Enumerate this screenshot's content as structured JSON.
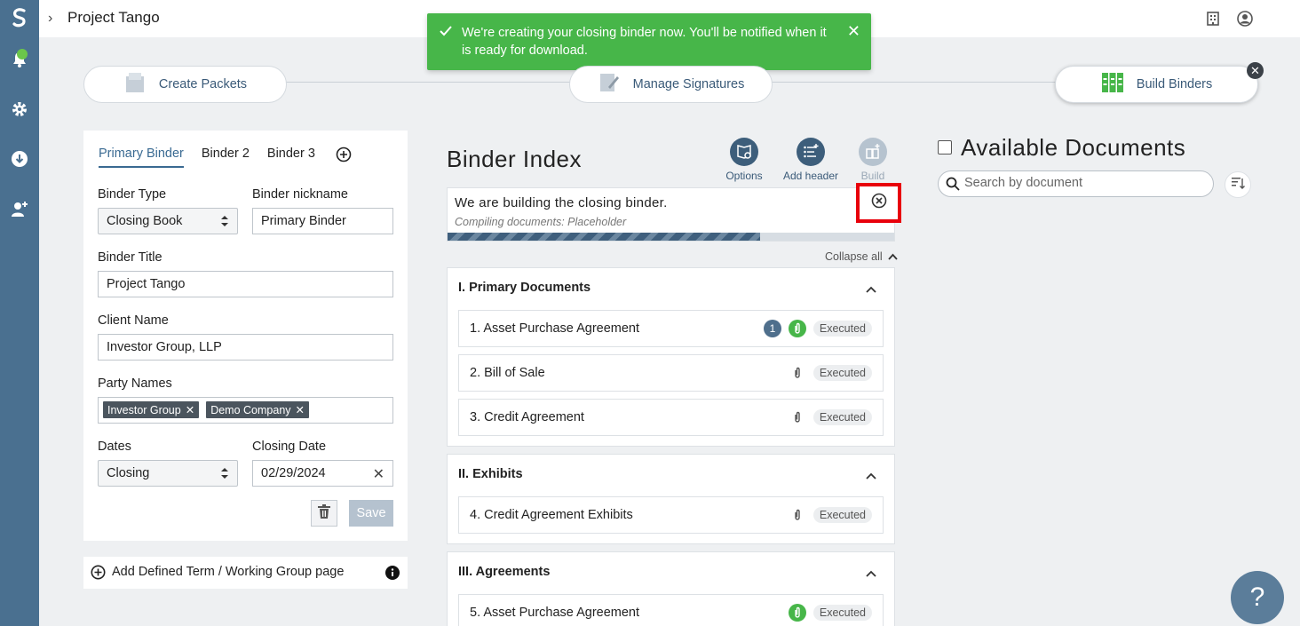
{
  "app": {
    "title": "Project Tango"
  },
  "toast": {
    "message": "We're creating your closing binder now. You'll be notified when it is ready for download."
  },
  "steps": [
    {
      "label": "Create Packets",
      "icon": "packet-icon"
    },
    {
      "label": "Manage Signatures",
      "icon": "signature-icon"
    },
    {
      "label": "Build Binders",
      "icon": "binders-icon"
    }
  ],
  "binder_tabs": [
    "Primary Binder",
    "Binder 2",
    "Binder 3"
  ],
  "form": {
    "binder_type_label": "Binder Type",
    "binder_type_value": "Closing Book",
    "nickname_label": "Binder nickname",
    "nickname_value": "Primary Binder",
    "title_label": "Binder Title",
    "title_value": "Project Tango",
    "client_label": "Client Name",
    "client_value": "Investor Group, LLP",
    "parties_label": "Party Names",
    "parties": [
      "Investor Group",
      "Demo Company"
    ],
    "dates_label": "Dates",
    "dates_value": "Closing",
    "closing_date_label": "Closing Date",
    "closing_date_value": "02/29/2024",
    "save_label": "Save"
  },
  "add_term": {
    "label": "Add Defined Term / Working Group page"
  },
  "binder_index": {
    "title": "Binder Index",
    "tools": {
      "options": "Options",
      "add_header": "Add header",
      "build": "Build"
    },
    "build_status": {
      "title": "We are building the closing binder.",
      "subtitle": "Compiling documents: Placeholder",
      "progress": 0.7
    },
    "collapse_all": "Collapse all",
    "sections": [
      {
        "title": "I. Primary Documents",
        "docs": [
          {
            "name": "1. Asset Purchase Agreement",
            "status": "Executed",
            "count": "1",
            "clip": "green"
          },
          {
            "name": "2. Bill of Sale",
            "status": "Executed",
            "clip": "plain"
          },
          {
            "name": "3. Credit Agreement",
            "status": "Executed",
            "clip": "plain"
          }
        ]
      },
      {
        "title": "II. Exhibits",
        "docs": [
          {
            "name": "4. Credit Agreement Exhibits",
            "status": "Executed",
            "clip": "plain"
          }
        ]
      },
      {
        "title": "III. Agreements",
        "docs": [
          {
            "name": "5. Asset Purchase Agreement",
            "status": "Executed",
            "clip": "green"
          }
        ]
      }
    ]
  },
  "available": {
    "title": "Available Documents",
    "search_placeholder": "Search by document"
  },
  "help": {
    "label": "?"
  },
  "colors": {
    "rail": "#4a7090",
    "accent": "#3d5e7b",
    "success": "#47b649",
    "highlight": "#e8000b"
  }
}
